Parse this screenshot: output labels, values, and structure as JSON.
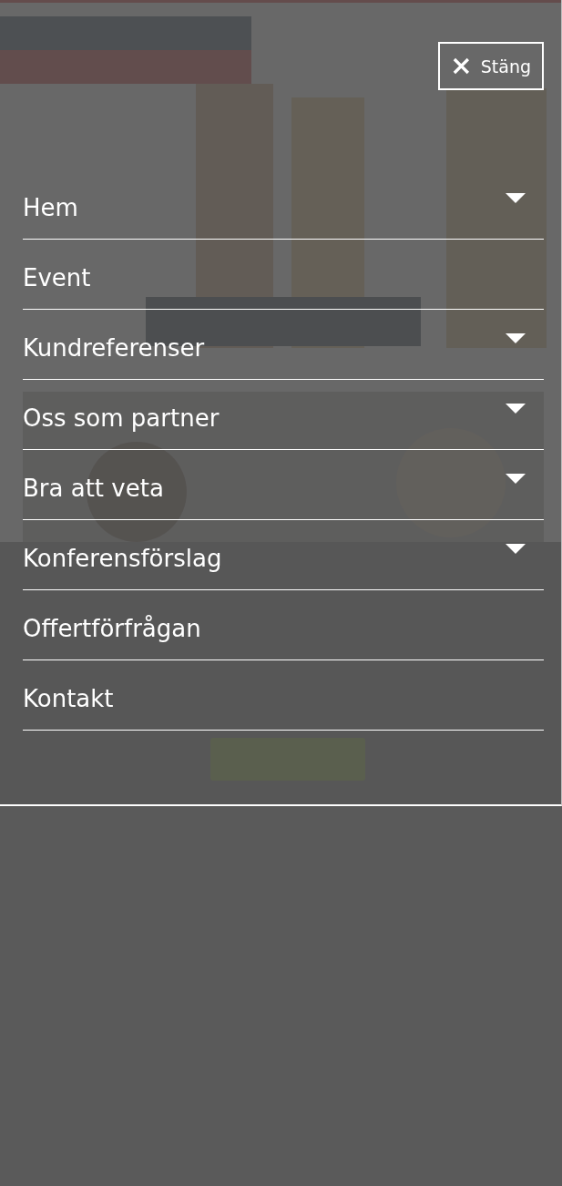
{
  "menu": {
    "close_button": {
      "label": "Stäng"
    },
    "items": [
      {
        "label": "Hem",
        "expandable": true
      },
      {
        "label": "Event",
        "expandable": false
      },
      {
        "label": "Kundreferenser",
        "expandable": true
      },
      {
        "label": "Oss som partner",
        "expandable": true
      },
      {
        "label": "Bra att veta",
        "expandable": true
      },
      {
        "label": "Konferensförslag",
        "expandable": true
      },
      {
        "label": "Offertförfrågan",
        "expandable": false
      },
      {
        "label": "Kontakt",
        "expandable": false
      }
    ]
  }
}
